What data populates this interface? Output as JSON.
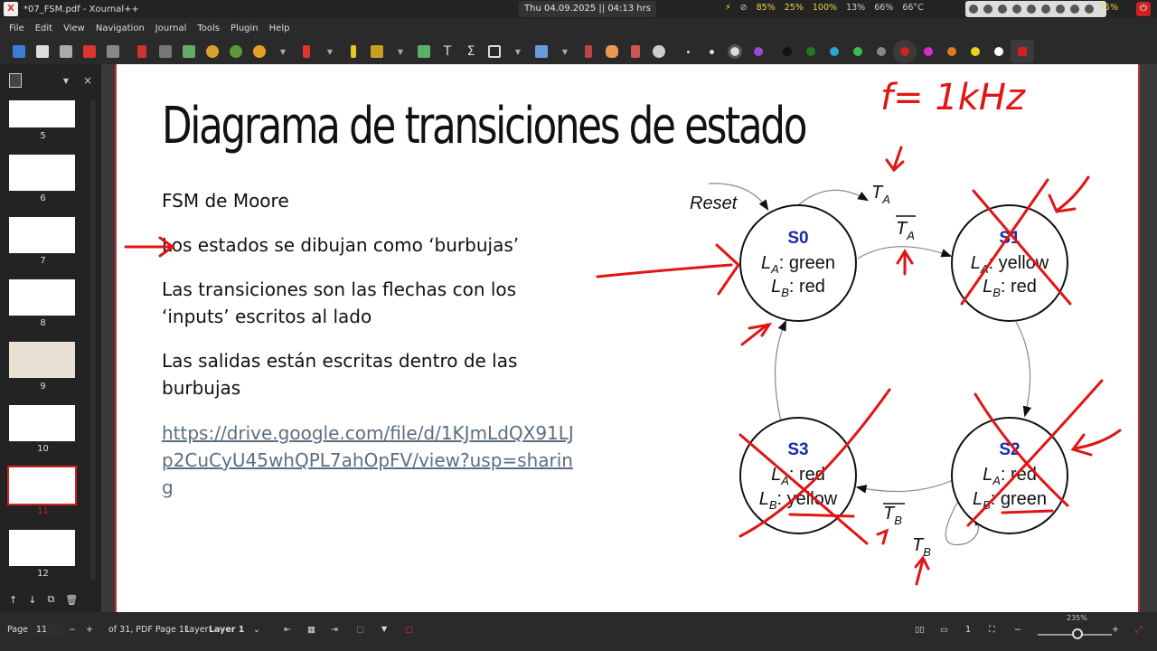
{
  "system_bar": {
    "app_title": "*07_FSM.pdf - Xournal++",
    "datetime": "Thu 04.09.2025  ||  04:13 hrs",
    "stats": [
      "85%",
      "25%",
      "100%",
      "13%",
      "66%",
      "66°C"
    ],
    "battery": "75%"
  },
  "menu": {
    "items": [
      "File",
      "Edit",
      "View",
      "Navigation",
      "Journal",
      "Tools",
      "Plugin",
      "Help"
    ]
  },
  "toolbar": {
    "colors": [
      "#111111",
      "#1f7a1f",
      "#2aa6c8",
      "#34c04a",
      "#888888",
      "#d21f1f",
      "#d42ad4",
      "#e07a1a",
      "#e8d21a",
      "#ffffff"
    ],
    "selected_color": "#d21f1f"
  },
  "sidebar": {
    "page_numbers": [
      "5",
      "6",
      "7",
      "8",
      "9",
      "10",
      "11",
      "12"
    ],
    "selected_page": "11"
  },
  "slide": {
    "title": "Diagrama de transiciones de estado",
    "bullets": [
      "FSM de Moore",
      "Los estados se dibujan como ‘burbujas’",
      "Las transiciones son las flechas con los",
      "‘inputs’ escritos al lado",
      "Las salidas están escritas dentro de las",
      "burbujas"
    ],
    "link_lines": [
      "https://drive.google.com/file/d/1KJmLdQX91LJ",
      "p2CuCyU45whQPL7ahOpFV/view?usp=sharin",
      "g"
    ],
    "diagram": {
      "reset": "Reset",
      "states": [
        {
          "name": "S0",
          "la": "green",
          "lb": "red"
        },
        {
          "name": "S1",
          "la": "yellow",
          "lb": "red"
        },
        {
          "name": "S2",
          "la": "red",
          "lb": "green"
        },
        {
          "name": "S3",
          "la": "red",
          "lb": "yellow"
        }
      ],
      "l_letter": "L",
      "sub_a": "A",
      "sub_b": "B",
      "sep": ":",
      "t_letter": "T"
    },
    "annotation": "f= 1kHz"
  },
  "status": {
    "page_label": "Page",
    "page_value": "11",
    "of_label": "of 31, PDF Page 11",
    "layer_label": "Layer",
    "layer_value": "Layer 1",
    "zoom": "235%"
  }
}
